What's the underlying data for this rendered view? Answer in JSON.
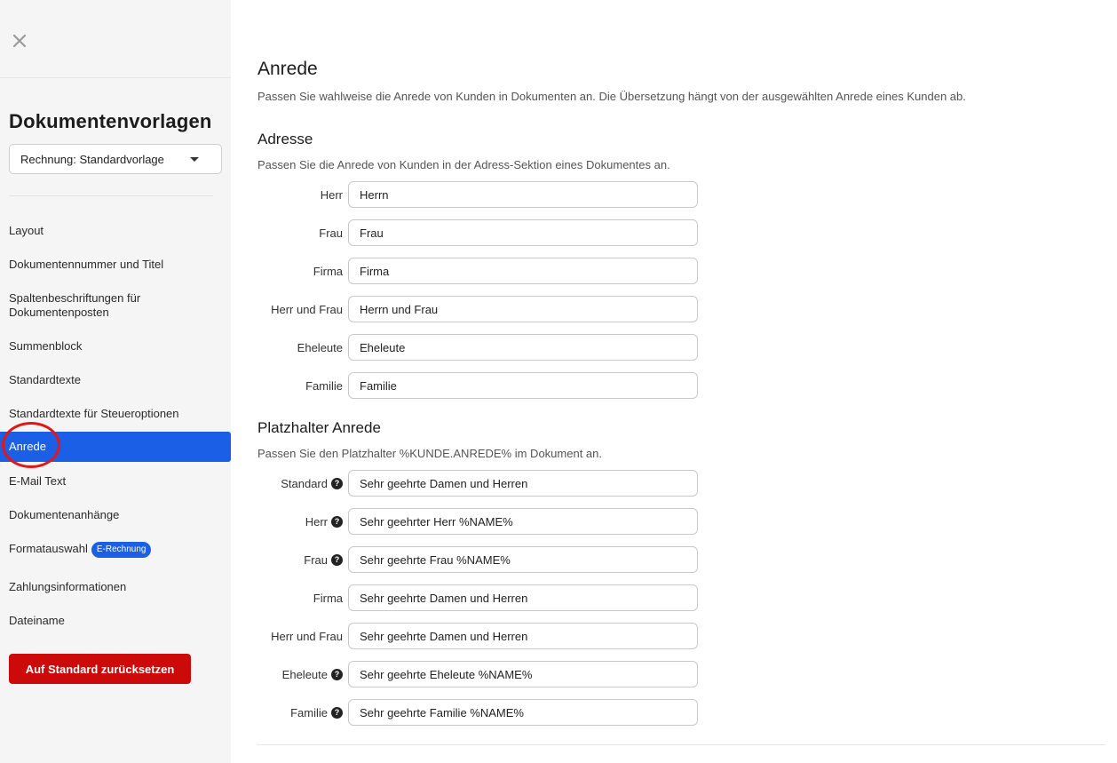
{
  "sidebar": {
    "title": "Dokumentenvorlagen",
    "template_select": "Rechnung: Standardvorlage",
    "items": [
      {
        "label": "Layout"
      },
      {
        "label": "Dokumentennummer und Titel"
      },
      {
        "label": "Spaltenbeschriftungen für Dokumentenposten"
      },
      {
        "label": "Summenblock"
      },
      {
        "label": "Standardtexte"
      },
      {
        "label": "Standardtexte für Steueroptionen"
      },
      {
        "label": "Anrede"
      },
      {
        "label": "E-Mail Text"
      },
      {
        "label": "Dokumentenanhänge"
      },
      {
        "label": "Formatauswahl",
        "badge": "E-Rechnung"
      },
      {
        "label": "Zahlungsinformationen"
      },
      {
        "label": "Dateiname"
      }
    ],
    "active_item": "Anrede",
    "reset_button": "Auf Standard zurücksetzen"
  },
  "main": {
    "title": "Anrede",
    "description": "Passen Sie wahlweise die Anrede von Kunden in Dokumenten an. Die Übersetzung hängt von der ausgewählten Anrede eines Kunden ab.",
    "address": {
      "title": "Adresse",
      "description": "Passen Sie die Anrede von Kunden in der Adress-Sektion eines Dokumentes an.",
      "fields": [
        {
          "label": "Herr",
          "value": "Herrn"
        },
        {
          "label": "Frau",
          "value": "Frau"
        },
        {
          "label": "Firma",
          "value": "Firma"
        },
        {
          "label": "Herr und Frau",
          "value": "Herrn und Frau"
        },
        {
          "label": "Eheleute",
          "value": "Eheleute"
        },
        {
          "label": "Familie",
          "value": "Familie"
        }
      ]
    },
    "placeholder": {
      "title": "Platzhalter Anrede",
      "description": "Passen Sie den Platzhalter %KUNDE.ANREDE% im Dokument an.",
      "fields": [
        {
          "label": "Standard",
          "value": "Sehr geehrte Damen und Herren",
          "help": true
        },
        {
          "label": "Herr",
          "value": "Sehr geehrter Herr %NAME%",
          "help": true
        },
        {
          "label": "Frau",
          "value": "Sehr geehrte Frau %NAME%",
          "help": true
        },
        {
          "label": "Firma",
          "value": "Sehr geehrte Damen und Herren",
          "help": false
        },
        {
          "label": "Herr und Frau",
          "value": "Sehr geehrte Damen und Herren",
          "help": false
        },
        {
          "label": "Eheleute",
          "value": "Sehr geehrte Eheleute %NAME%",
          "help": true
        },
        {
          "label": "Familie",
          "value": "Sehr geehrte Familie %NAME%",
          "help": true
        }
      ]
    }
  },
  "colors": {
    "accent": "#1a5fe6",
    "danger": "#cc0a0a",
    "annotation": "#e01818"
  }
}
